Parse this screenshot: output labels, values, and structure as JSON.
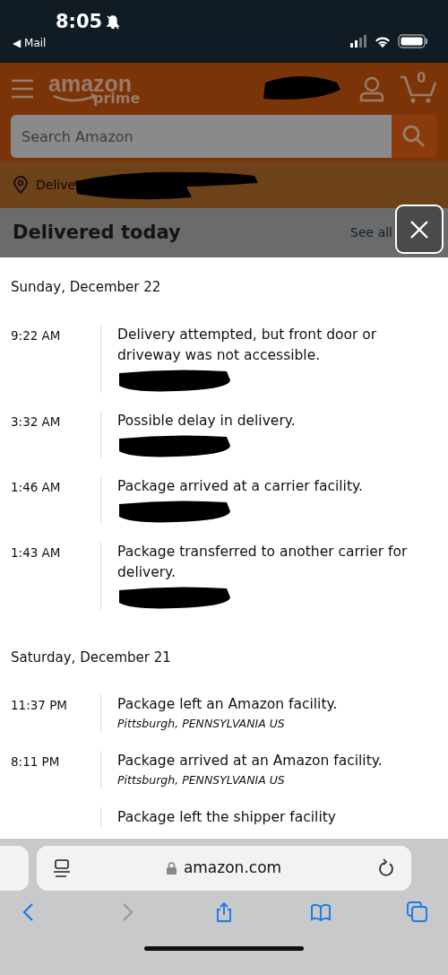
{
  "status_bar": {
    "time": "8:05",
    "back_label": "◀ Mail"
  },
  "header": {
    "logo": "amazon",
    "logo_sub": "prime",
    "cart_count": "0",
    "account_redacted": true
  },
  "search": {
    "placeholder": "Search Amazon"
  },
  "delivery_bar": {
    "label": "Delive",
    "redacted": true
  },
  "section": {
    "title": "Delivered today",
    "link": "See all"
  },
  "tracking": {
    "days": [
      {
        "date": "Sunday, December 22",
        "events": [
          {
            "time": "9:22 AM",
            "description": "Delivery attempted, but front door or driveway was not accessible.",
            "location_redacted": true
          },
          {
            "time": "3:32 AM",
            "description": "Possible delay in delivery.",
            "location_redacted": true
          },
          {
            "time": "1:46 AM",
            "description": "Package arrived at a carrier facility.",
            "location_redacted": true
          },
          {
            "time": "1:43 AM",
            "description": "Package transferred to another carrier for delivery.",
            "location_redacted": true
          }
        ]
      },
      {
        "date": "Saturday, December 21",
        "events": [
          {
            "time": "11:37 PM",
            "description": "Package left an Amazon facility.",
            "location": "Pittsburgh, PENNSYLVANIA US"
          },
          {
            "time": "8:11 PM",
            "description": "Package arrived at an Amazon facility.",
            "location": "Pittsburgh, PENNSYLVANIA US"
          },
          {
            "description": "Package left the shipper facility"
          }
        ]
      }
    ]
  },
  "browser": {
    "url": "amazon.com",
    "toolbar": [
      {
        "kind": "back",
        "disabled": false
      },
      {
        "kind": "forward",
        "disabled": true
      },
      {
        "kind": "share",
        "disabled": false
      },
      {
        "kind": "bookmarks",
        "disabled": false
      },
      {
        "kind": "tabs",
        "disabled": false
      }
    ]
  }
}
